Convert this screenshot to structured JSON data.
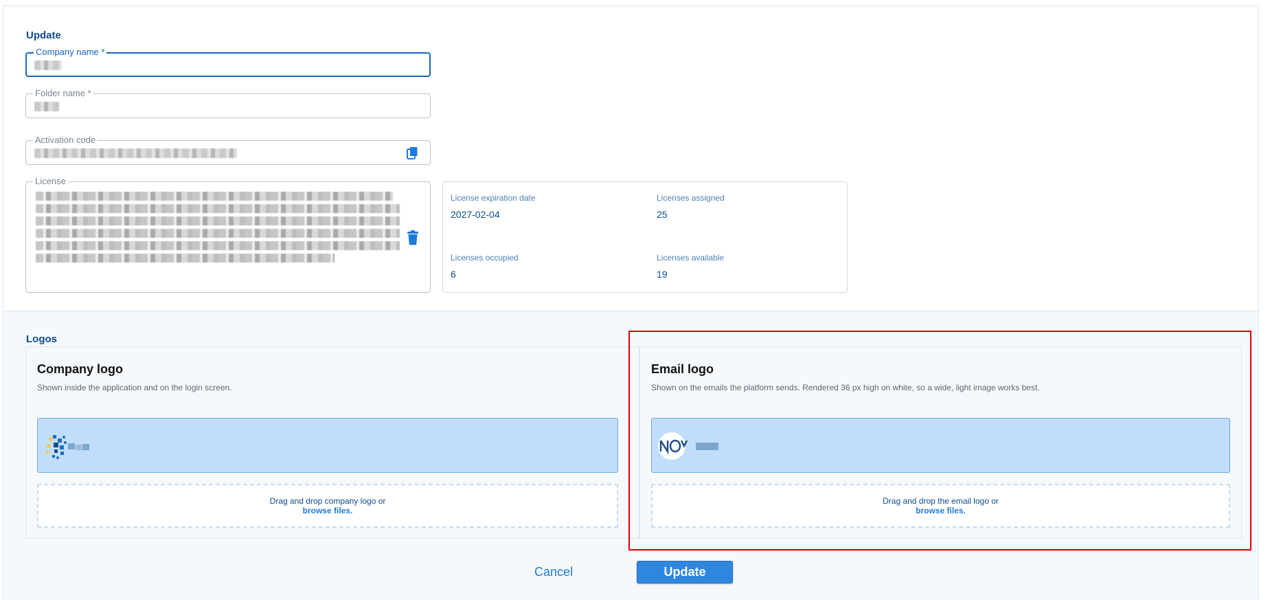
{
  "update_section": {
    "title": "Update",
    "company_name": {
      "label": "Company name *",
      "value": ""
    },
    "folder_name": {
      "label": "Folder name *",
      "value": ""
    },
    "activation_code": {
      "label": "Activation code",
      "value": ""
    },
    "license": {
      "label": "License",
      "value": ""
    }
  },
  "license_info": {
    "expiration_label": "License expiration date",
    "expiration_value": "2027-02-04",
    "assigned_label": "Licenses assigned",
    "assigned_value": "25",
    "occupied_label": "Licenses occupied",
    "occupied_value": "6",
    "available_label": "Licenses available",
    "available_value": "19"
  },
  "logos_section": {
    "title": "Logos",
    "company_logo": {
      "title": "Company logo",
      "description": "Shown inside the application and on the login screen.",
      "dropzone_text": "Drag and drop company logo or",
      "browse_text": "browse files."
    },
    "email_logo": {
      "title": "Email logo",
      "description": "Shown on the emails the platform sends. Rendered 36 px high on white, so a wide, light image works best.",
      "dropzone_text": "Drag and drop the email logo or",
      "browse_text": "browse files."
    }
  },
  "actions": {
    "cancel_label": "Cancel",
    "update_label": "Update"
  },
  "colors": {
    "accent": "#1565c0",
    "title": "#0d4d8c",
    "preview_bg": "#c0defb",
    "highlight": "#e00000"
  }
}
